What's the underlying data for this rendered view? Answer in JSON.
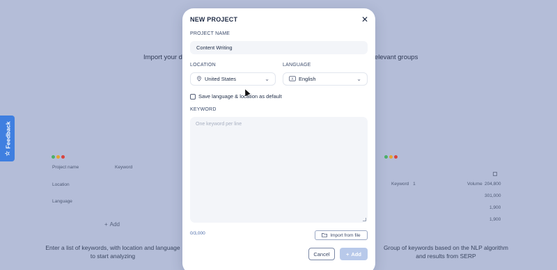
{
  "background": {
    "heading_left": "Import your de",
    "heading_right": "elevant groups",
    "feedback_label": "Feedback",
    "left_panel": {
      "project_name_label": "Project name",
      "keyword_label": "Keyword",
      "location_label": "Location",
      "language_label": "Language",
      "add_label": "Add",
      "caption": "Enter a list of keywords, with location and language to start analyzing"
    },
    "right_panel": {
      "keyword_label": "Keyword",
      "keyword_num": "1",
      "volume_label": "Volume",
      "volume_values": [
        "204,800",
        "301,000",
        "1,900",
        "1,900"
      ],
      "caption": "Group of keywords based on the NLP algorithm and results from SERP"
    },
    "colors": {
      "dot_green": "#4bb06a",
      "dot_yellow": "#e5a531",
      "dot_red": "#d9443d",
      "feedback_bg": "#3f7fe0"
    }
  },
  "modal": {
    "title": "NEW PROJECT",
    "close_icon": "close-icon",
    "project_name_label": "PROJECT NAME",
    "project_name_value": "Content Writing",
    "location_label": "LOCATION",
    "location_value": "United States",
    "language_label": "LANGUAGE",
    "language_value": "English",
    "save_default_label": "Save language & location as default",
    "keyword_label": "KEYWORD",
    "keyword_placeholder": "One keyword per line",
    "counter": "0/3,000",
    "import_label": "Import from file",
    "cancel_label": "Cancel",
    "add_label": "Add"
  }
}
